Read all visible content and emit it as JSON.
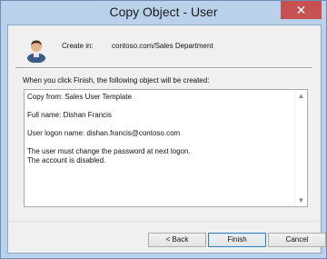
{
  "window": {
    "title": "Copy Object - User",
    "close_glyph": "✕"
  },
  "header": {
    "icon": "user-icon",
    "create_in_label": "Create in:",
    "create_in_value": "contoso.com/Sales Department"
  },
  "intro_text": "When you click Finish, the following object will be created:",
  "summary": {
    "lines": [
      "Copy from: Sales User Template",
      "",
      "Full name: Dishan Francis",
      "",
      "User logon name: dishan.francis@contoso.com",
      "",
      "The user must change the password at next logon.",
      "The account is disabled."
    ]
  },
  "scrollbar": {
    "up_glyph": "▲",
    "down_glyph": "▼"
  },
  "buttons": {
    "back": "< Back",
    "finish": "Finish",
    "cancel": "Cancel"
  },
  "colors": {
    "frame": "#b9d1ea",
    "close": "#c75050",
    "client": "#f0f0f0"
  }
}
